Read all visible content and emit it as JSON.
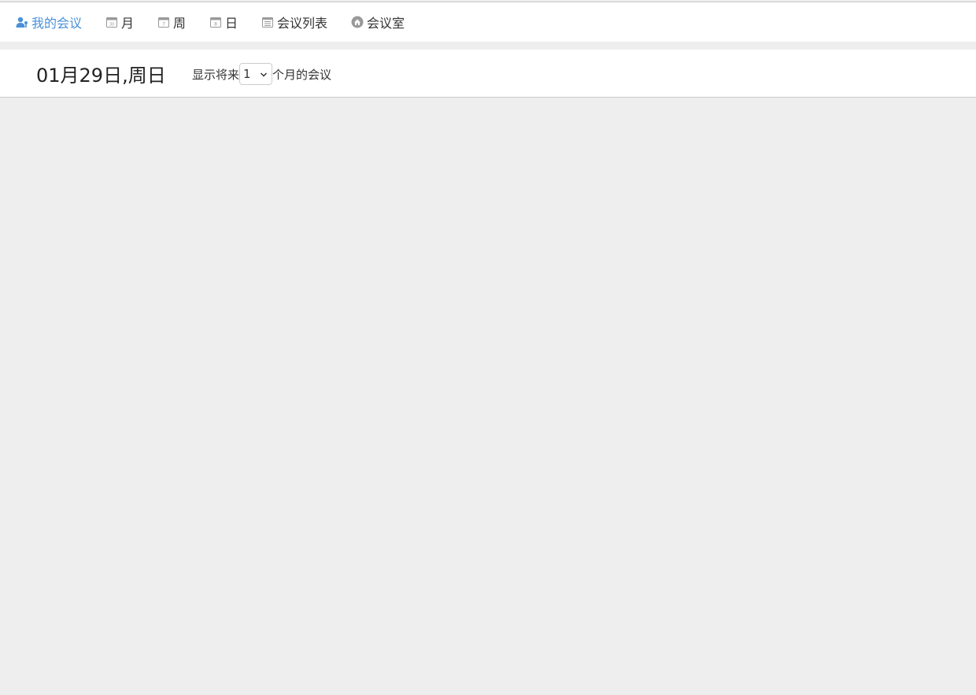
{
  "nav": {
    "items": [
      {
        "label": "我的会议",
        "icon": "user-icon",
        "active": true
      },
      {
        "label": "月",
        "icon": "calendar-month-icon"
      },
      {
        "label": "周",
        "icon": "calendar-week-icon"
      },
      {
        "label": "日",
        "icon": "calendar-day-icon"
      },
      {
        "label": "会议列表",
        "icon": "list-icon"
      },
      {
        "label": "会议室",
        "icon": "room-icon"
      }
    ],
    "month_icon_text": "30",
    "week_icon_text": "7",
    "day_icon_text": "8"
  },
  "header": {
    "date_title": "01月29日,周日",
    "show_prefix": "显示将来",
    "months_value": "1",
    "show_suffix": "个月的会议"
  },
  "colors": {
    "active": "#4a90d9",
    "background": "#eeeeee",
    "icon_gray": "#999999"
  }
}
